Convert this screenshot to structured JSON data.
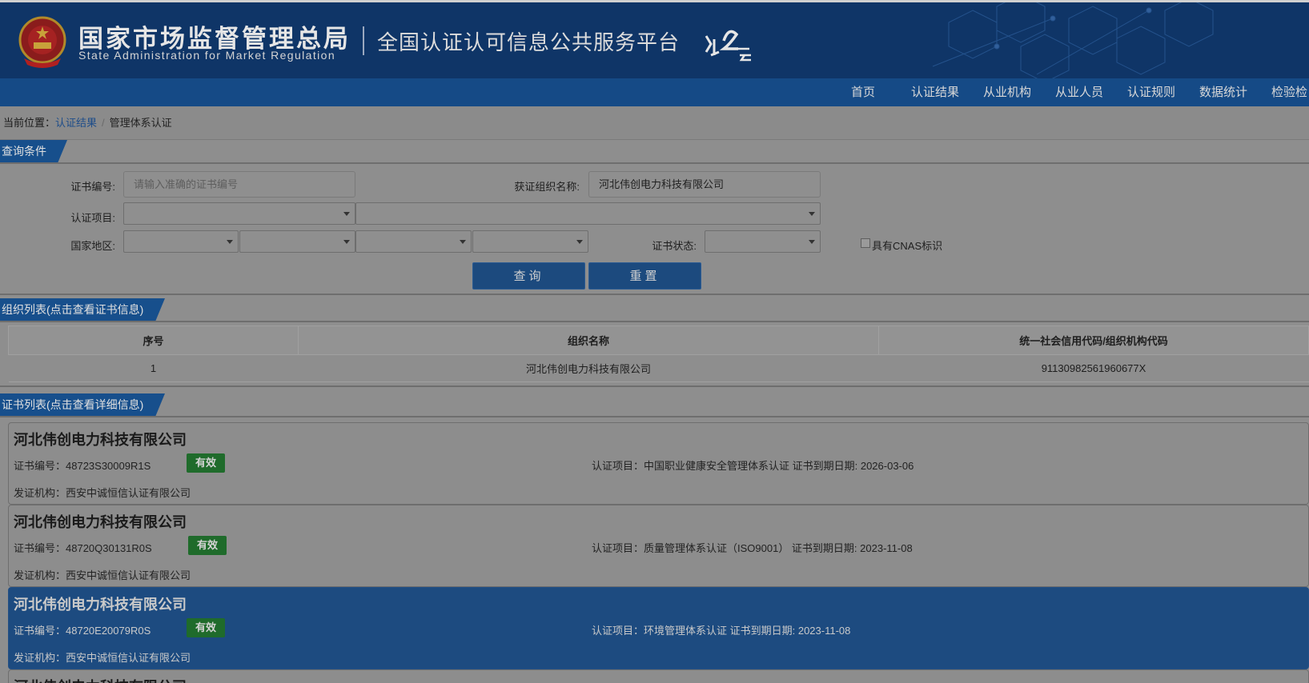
{
  "header": {
    "title_cn": "国家市场监督管理总局",
    "title_en": "State Administration  for  Market Regulation",
    "platform": "全国认证认可信息公共服务平台",
    "logo_text": "认云"
  },
  "nav": {
    "items": [
      {
        "label": "首页"
      },
      {
        "label": "认证结果"
      },
      {
        "label": "从业机构"
      },
      {
        "label": "从业人员"
      },
      {
        "label": "认证规则"
      },
      {
        "label": "数据统计"
      },
      {
        "label": "检验检"
      }
    ]
  },
  "breadcrumb": {
    "label": "当前位置：",
    "link": "认证结果",
    "separator": "/",
    "current": "管理体系认证"
  },
  "query": {
    "section_title": "查询条件",
    "cert_no_label": "证书编号:",
    "cert_no_placeholder": "请输入准确的证书编号",
    "org_name_label": "获证组织名称:",
    "org_name_value": "河北伟创电力科技有限公司",
    "project_label": "认证项目:",
    "region_label": "国家地区:",
    "status_label": "证书状态:",
    "cnas_label": "具有CNAS标识",
    "search_button": "查询",
    "reset_button": "重置"
  },
  "org_list": {
    "section_title": "组织列表(点击查看证书信息)",
    "columns": [
      "序号",
      "组织名称",
      "统一社会信用代码/组织机构代码"
    ],
    "rows": [
      {
        "index": "1",
        "name": "河北伟创电力科技有限公司",
        "code": "91130982561960677X"
      }
    ]
  },
  "cert_list": {
    "section_title": "证书列表(点击查看详细信息)",
    "items": [
      {
        "org": "河北伟创电力科技有限公司",
        "cert_no": "证书编号：48723S30009R1S",
        "status": "有效",
        "project": "认证项目：中国职业健康安全管理体系认证   证书到期日期: 2026-03-06",
        "issuer": "发证机构：西安中诚恒信认证有限公司"
      },
      {
        "org": "河北伟创电力科技有限公司",
        "cert_no": "证书编号：48720Q30131R0S",
        "status": "有效",
        "project": "认证项目：质量管理体系认证（ISO9001）   证书到期日期: 2023-11-08",
        "issuer": "发证机构：西安中诚恒信认证有限公司"
      },
      {
        "org": "河北伟创电力科技有限公司",
        "cert_no": "证书编号：48720E20079R0S",
        "status": "有效",
        "project": "认证项目：环境管理体系认证   证书到期日期: 2023-11-08",
        "issuer": "发证机构：西安中诚恒信认证有限公司"
      },
      {
        "org": "河北伟创电力科技有限公司"
      }
    ]
  },
  "colors": {
    "header_bg": "#0f3567",
    "nav_bg": "#154a86",
    "section_tab": "#174f8c",
    "active_cert": "#1d4b80",
    "valid_badge": "#1f6b2b"
  }
}
